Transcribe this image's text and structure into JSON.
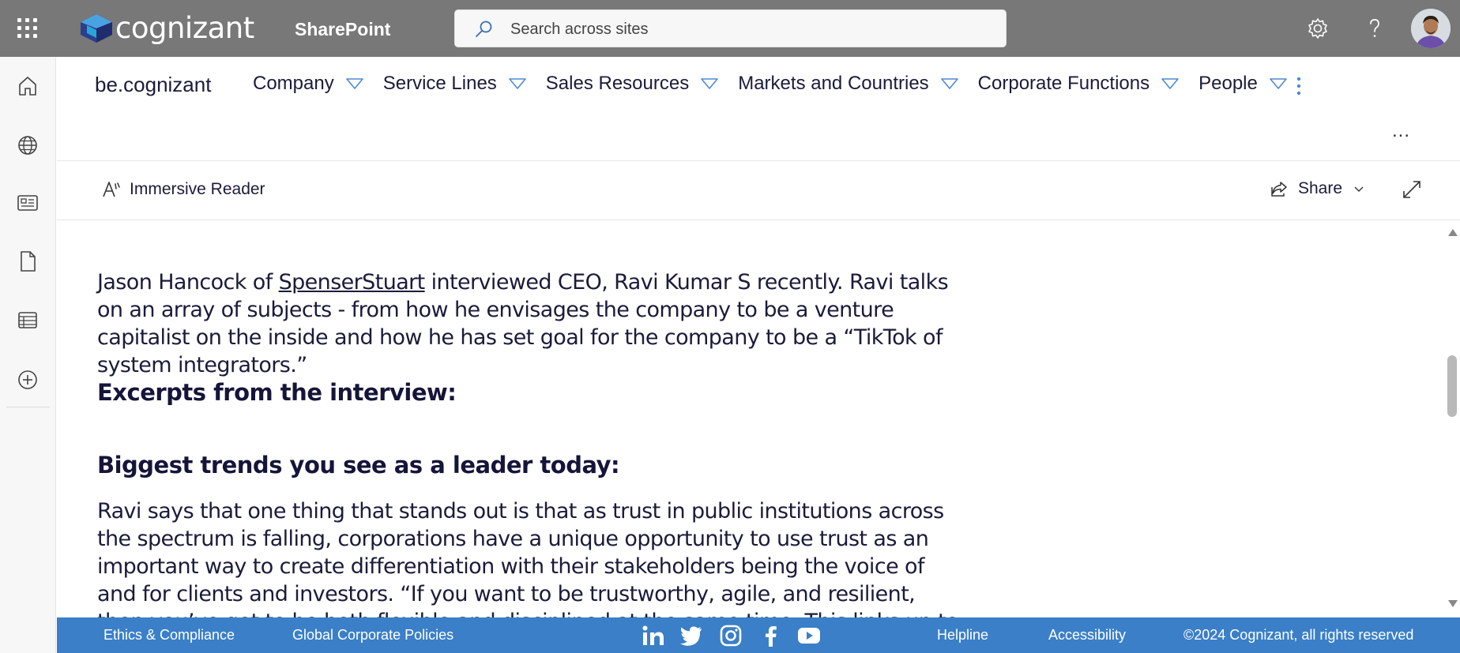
{
  "suitebar": {
    "brand": "cognizant",
    "app_name": "SharePoint",
    "search_placeholder": "Search across sites"
  },
  "site": {
    "name": "be.cognizant",
    "nav": [
      {
        "label": "Company"
      },
      {
        "label": "Service Lines"
      },
      {
        "label": "Sales Resources"
      },
      {
        "label": "Markets and Countries"
      },
      {
        "label": "Corporate Functions"
      },
      {
        "label": "People"
      }
    ],
    "more": "..."
  },
  "commandbar": {
    "immersive_reader": "Immersive Reader",
    "share": "Share"
  },
  "article": {
    "p1_pre": "Jason Hancock of ",
    "p1_link": "SpenserStuart",
    "p1_post": " interviewed CEO, Ravi Kumar S recently. Ravi talks on an array of subjects - from how he envisages the company to be a venture capitalist on the inside and how he has set goal for the company to be a “TikTok of system integrators.”",
    "h_excerpts": "Excerpts from the interview:",
    "h_trends": "Biggest trends you see as a leader today:",
    "p2": "Ravi says that one thing that stands out is that as trust in public institutions across the spectrum is falling, corporations have a unique opportunity to use trust as an important way to create differentiation with their stakeholders being the voice of and for clients and investors. “If you want to be trustworthy, agile, and resilient, then you’ve got to be both flexible and disciplined at the same time. This links up to something I keep going to over and"
  },
  "footer": {
    "ethics": "Ethics & Compliance",
    "policies": "Global Corporate Policies",
    "helpline": "Helpline",
    "accessibility": "Accessibility",
    "copyright": "©2024 Cognizant, all rights reserved",
    "social": [
      "linkedin-icon",
      "twitter-icon",
      "instagram-icon",
      "facebook-icon",
      "youtube-icon"
    ]
  },
  "colors": {
    "suitebar": "#777877",
    "footer": "#3a7fc8",
    "text_dark": "#1b1b3a",
    "nav_triangle": "#4f8ad1"
  }
}
